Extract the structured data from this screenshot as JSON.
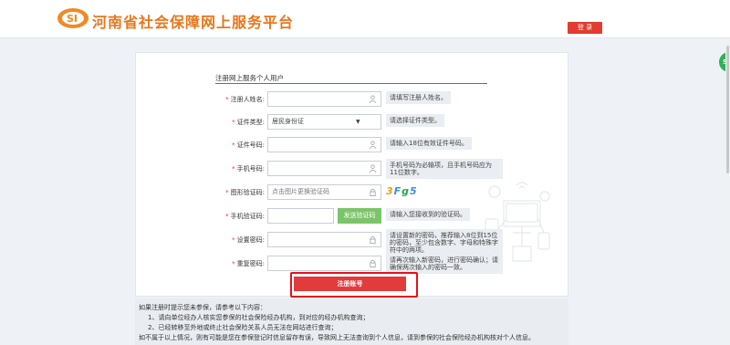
{
  "header": {
    "logo_text": "SI",
    "site_title": "河南省社会保障网上服务平台",
    "login_label": "登 录"
  },
  "side_tab": {
    "label": "SI"
  },
  "form": {
    "section_title": "注册网上服务个人用户",
    "fields": [
      {
        "label": "注册人姓名:",
        "value": "",
        "placeholder": "",
        "hint": "请填写注册人姓名。",
        "icon": "user-icon"
      },
      {
        "label": "证件类型:",
        "value": "居民身份证",
        "hint": "请选择证件类型。",
        "icon": "dropdown-caret"
      },
      {
        "label": "证件号码:",
        "value": "",
        "placeholder": "",
        "hint": "请输入18位有效证件号码。",
        "icon": "user-icon"
      },
      {
        "label": "手机号码:",
        "value": "",
        "placeholder": "",
        "hint": "手机号码为必输项，且手机号码应为11位数字。",
        "icon": "user-icon"
      },
      {
        "label": "图形验证码:",
        "value": "",
        "placeholder": "点击图片更换验证码",
        "hint": "",
        "icon": "lock-icon"
      },
      {
        "label": "手机验证码:",
        "value": "",
        "placeholder": "",
        "hint": "请输入您接收到的验证码。",
        "icon": ""
      },
      {
        "label": "设置密码:",
        "value": "",
        "placeholder": "",
        "hint": "请设置新的密码，推荐输入8位到15位的密码，至少包含数字、字母和特殊字符中的两项。",
        "icon": "lock-icon"
      },
      {
        "label": "重复密码:",
        "value": "",
        "placeholder": "",
        "hint": "请再次输入新密码，进行密码确认；请确保两次输入的密码一致。",
        "icon": "lock-icon"
      }
    ],
    "captcha_text": "3Fg5",
    "sms_button_label": "发送验证码",
    "register_label": "注册账号"
  },
  "notice": {
    "line1": "如果注册时提示您未参保，请参考以下内容：",
    "line2": "1、请向单位经办人核实您参保的社会保险经办机构，到对应的经办机构查询；",
    "line3": "2、已经转移至外地或终止社会保险关系人员无法在网站进行查询；",
    "line4": "如不属于以上情况，则有可能是您在参保登记时信息留存有误，导致网上无法查询到个人信息，请到参保的社会保险经办机构核对个人信息。"
  },
  "colors": {
    "brand_orange": "#e8761c",
    "login_red": "#e23b2f",
    "register_red": "#e23b3b",
    "highlight_red": "#e5111b",
    "sms_green": "#7cc46a",
    "accent_blue": "#2f7ec3"
  }
}
